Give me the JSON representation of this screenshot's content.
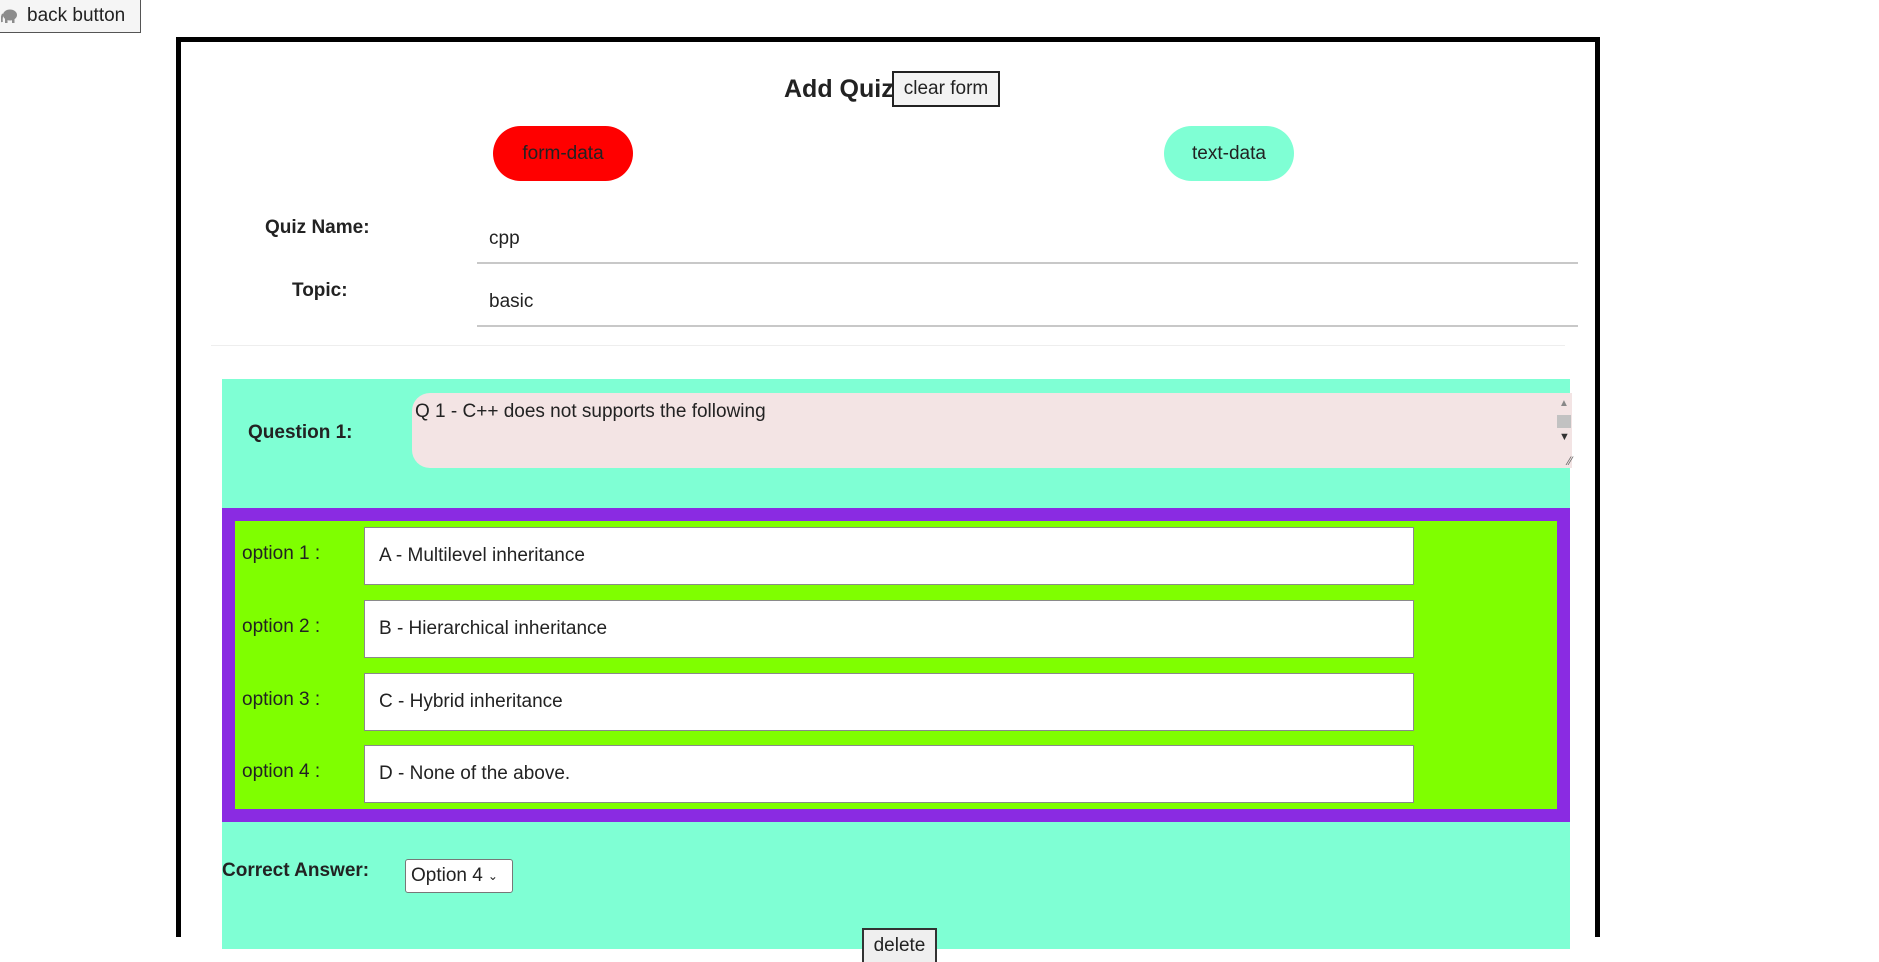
{
  "back_button": {
    "icon": "elephant-icon",
    "label": "back button"
  },
  "header": {
    "title": "Add Quiz",
    "clear_label": "clear form"
  },
  "toggles": {
    "form_data": "form-data",
    "text_data": "text-data"
  },
  "fields": {
    "quiz_name_label": "Quiz Name:",
    "quiz_name_value": "cpp",
    "topic_label": "Topic:",
    "topic_value": "basic"
  },
  "question": {
    "label": "Question 1:",
    "text": "Q 1 - C++ does not supports the following",
    "options": [
      {
        "label": "option 1 :",
        "value": "A - Multilevel inheritance"
      },
      {
        "label": "option 2 :",
        "value": "B - Hierarchical inheritance"
      },
      {
        "label": "option 3 :",
        "value": "C - Hybrid inheritance"
      },
      {
        "label": "option 4 :",
        "value": "D - None of the above."
      }
    ],
    "correct_answer_label": "Correct Answer:",
    "correct_answer_value": "Option 4",
    "delete_label": "delete"
  },
  "colors": {
    "active_toggle": "#ff0000",
    "inactive_toggle": "#7fffd4",
    "question_bg": "#7fffd4",
    "options_border": "#8a2be2",
    "options_bg": "#7fff00",
    "question_textarea_bg": "#f3e4e4"
  }
}
